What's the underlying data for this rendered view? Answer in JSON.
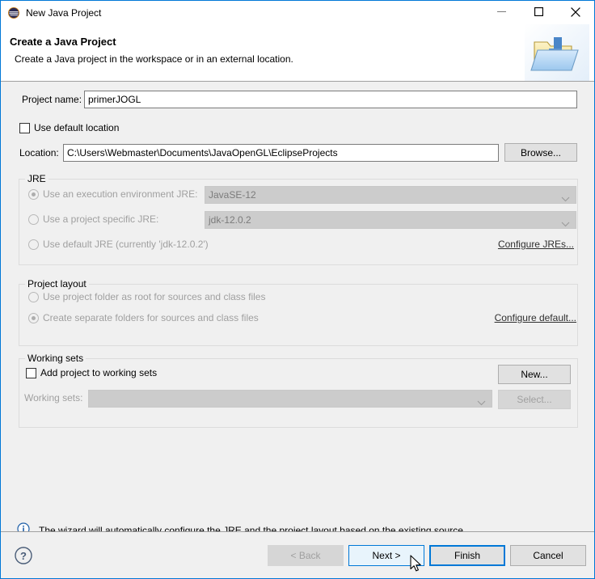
{
  "window": {
    "title": "New Java Project",
    "icon": "eclipse-icon",
    "controls": {
      "minimize": "minimize-icon",
      "maximize": "maximize-icon",
      "close": "close-icon"
    }
  },
  "header": {
    "title": "Create a Java Project",
    "description": "Create a Java project in the workspace or in an external location.",
    "icon": "java-project-folder-icon"
  },
  "form": {
    "project_name_label": "Project name:",
    "project_name_value": "primerJOGL",
    "project_name_placeholder": "",
    "use_default_location_label": "Use default location",
    "use_default_location_checked": false,
    "location_label": "Location:",
    "location_value": "C:\\Users\\Webmaster\\Documents\\JavaOpenGL\\EclipseProjects",
    "browse_label": "Browse..."
  },
  "jre": {
    "group_title": "JRE",
    "options": [
      {
        "label": "Use an execution environment JRE:",
        "selected": true
      },
      {
        "label": "Use a project specific JRE:",
        "selected": false
      },
      {
        "label": "Use default JRE (currently 'jdk-12.0.2')",
        "selected": false
      }
    ],
    "execution_environment_value": "JavaSE-12",
    "project_specific_value": "jdk-12.0.2",
    "configure_link": "Configure JREs..."
  },
  "project_layout": {
    "group_title": "Project layout",
    "options": [
      {
        "label": "Use project folder as root for sources and class files",
        "selected": false
      },
      {
        "label": "Create separate folders for sources and class files",
        "selected": true
      }
    ],
    "configure_link": "Configure default..."
  },
  "working_sets": {
    "group_title": "Working sets",
    "add_checkbox_label": "Add project to working sets",
    "add_checkbox_checked": false,
    "new_button": "New...",
    "working_sets_label": "Working sets:",
    "working_sets_value": "",
    "select_button": "Select..."
  },
  "status": {
    "icon": "info-icon",
    "message": "The wizard will automatically configure the JRE and the project layout based on the existing source."
  },
  "footer": {
    "help_icon": "help-icon",
    "back_label": "< Back",
    "next_label": "Next >",
    "finish_label": "Finish",
    "cancel_label": "Cancel"
  },
  "colors": {
    "accent": "#0078d7",
    "dialog_bg": "#f0f0f0",
    "field_bg": "#ffffff",
    "disabled_text": "#a0a0a0",
    "info_blue": "#1e5fa8"
  }
}
